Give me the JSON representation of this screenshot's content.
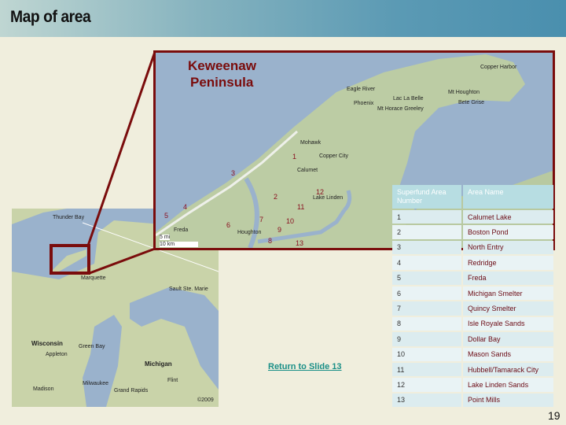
{
  "header": {
    "title": "Map of area"
  },
  "inset_map": {
    "title_line1": "Keweenaw",
    "title_line2": "Peninsula",
    "places": [
      "Copper Harbor",
      "Eagle River",
      "Phoenix",
      "Mt Horace Greeley",
      "Lac La Belle",
      "Mt Houghton",
      "Bete Grise",
      "Mohawk",
      "Copper City",
      "Calumet",
      "Lake Linden",
      "Houghton",
      "Freda"
    ],
    "scale": [
      "5 mi",
      "10 km"
    ],
    "markers": [
      "1",
      "2",
      "3",
      "4",
      "5",
      "6",
      "7",
      "8",
      "9",
      "10",
      "11",
      "12",
      "13"
    ]
  },
  "region_map": {
    "places": [
      "Thunder Bay",
      "Marquette",
      "Sault Ste. Marie",
      "Wisconsin",
      "Green Bay",
      "Appleton",
      "Michigan",
      "Milwaukee",
      "Grand Rapids",
      "Flint",
      "Madison"
    ],
    "copyright": "©2009"
  },
  "table": {
    "headers": [
      "Superfund Area Number",
      "Area Name"
    ],
    "rows": [
      [
        "1",
        "Calumet Lake"
      ],
      [
        "2",
        "Boston Pond"
      ],
      [
        "3",
        "North Entry"
      ],
      [
        "4",
        "Redridge"
      ],
      [
        "5",
        "Freda"
      ],
      [
        "6",
        "Michigan Smelter"
      ],
      [
        "7",
        "Quincy Smelter"
      ],
      [
        "8",
        "Isle Royale Sands"
      ],
      [
        "9",
        "Dollar Bay"
      ],
      [
        "10",
        "Mason Sands"
      ],
      [
        "11",
        "Hubbell/Tamarack City"
      ],
      [
        "12",
        "Lake Linden Sands"
      ],
      [
        "13",
        "Point Mills"
      ]
    ]
  },
  "link": {
    "return_label": "Return to Slide 13"
  },
  "page_number": "19",
  "colors": {
    "frame": "#7a0c0c",
    "water": "#9ab2cc",
    "land": "#c9d3a9",
    "link": "#1a8f87"
  }
}
